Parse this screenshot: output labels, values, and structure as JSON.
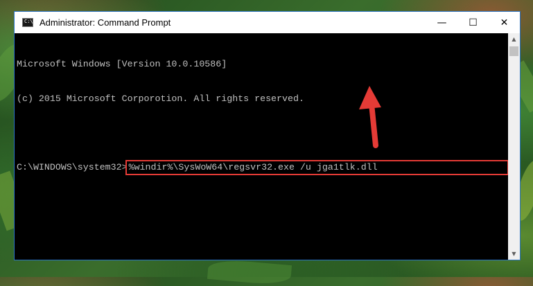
{
  "window": {
    "title": "Administrator: Command Prompt",
    "icon_label": "C:\\",
    "minimize_glyph": "—",
    "maximize_glyph": "☐",
    "close_glyph": "✕"
  },
  "console": {
    "line1": "Microsoft Windows [Version 10.0.10586]",
    "line2": "(c) 2015 Microsoft Corporotion. All rights reserved.",
    "prompt": "C:\\WINDOWS\\system32>",
    "command": "%windir%\\SysWoW64\\regsvr32.exe /u jga1tlk.dll"
  },
  "scrollbar": {
    "up_glyph": "▲",
    "down_glyph": "▼"
  },
  "annotation": {
    "highlight_color": "#e53b36",
    "arrow_color": "#e53b36"
  }
}
